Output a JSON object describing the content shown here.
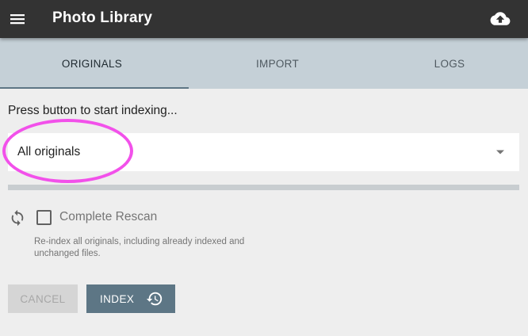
{
  "app": {
    "title": "Photo Library"
  },
  "toolbar": {
    "menu_icon": "hamburger-menu-icon",
    "upload_icon": "cloud-upload-icon"
  },
  "tabs": [
    {
      "label": "ORIGINALS",
      "active": true
    },
    {
      "label": "IMPORT",
      "active": false
    },
    {
      "label": "LOGS",
      "active": false
    }
  ],
  "index": {
    "prompt": "Press button to start indexing...",
    "folder_select": {
      "value": "All originals",
      "arrow_icon": "dropdown-arrow-icon"
    },
    "progress": 0,
    "rescan": {
      "label": "Complete Rescan",
      "checked": false,
      "hint": "Re-index all originals, including already indexed and unchanged files.",
      "icon": "refresh-icon"
    },
    "buttons": {
      "cancel": "CANCEL",
      "index": "INDEX",
      "index_icon": "history-icon"
    }
  },
  "colors": {
    "toolbar": "#333333",
    "tabs": "#c5d0d7",
    "accent": "#5d7685",
    "highlight": "#f251ea"
  }
}
